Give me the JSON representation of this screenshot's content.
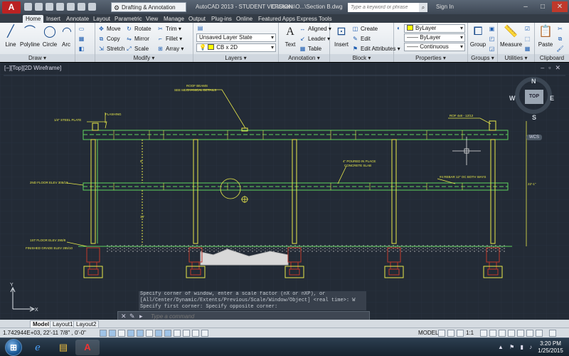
{
  "titlebar": {
    "app_logo": "A",
    "workspace": "Drafting & Annotation",
    "title": "AutoCAD 2013 - STUDENT VERSION",
    "file": "C:\\Users\\O...\\Section B.dwg",
    "search_placeholder": "Type a keyword or phrase",
    "sign_in": "Sign In"
  },
  "tabs": [
    "Home",
    "Insert",
    "Annotate",
    "Layout",
    "Parametric",
    "View",
    "Manage",
    "Output",
    "Plug-ins",
    "Online",
    "Featured Apps",
    "Express Tools"
  ],
  "ribbon": {
    "draw": {
      "title": "Draw ▾",
      "line": "Line",
      "polyline": "Polyline",
      "circle": "Circle",
      "arc": "Arc"
    },
    "modify": {
      "title": "Modify ▾",
      "move": "Move",
      "rotate": "Rotate",
      "trim": "Trim ▾",
      "copy": "Copy",
      "mirror": "Mirror",
      "fillet": "Fillet ▾",
      "stretch": "Stretch",
      "scale": "Scale",
      "array": "Array ▾"
    },
    "layers": {
      "title": "Layers ▾",
      "layer_state": "Unsaved Layer State",
      "current_layer": "CB x 2D"
    },
    "annotation": {
      "title": "Annotation ▾",
      "text": "Text",
      "aligned": "Aligned ▾",
      "leader": "Leader ▾",
      "table": "Table"
    },
    "block": {
      "title": "Block ▾",
      "insert": "Insert",
      "create": "Create",
      "edit": "Edit",
      "edit_attributes": "Edit Attributes ▾"
    },
    "properties": {
      "title": "Properties ▾",
      "color": "ByLayer",
      "linetype": "ByLayer",
      "lineweight": "Continuous"
    },
    "groups": {
      "title": "Groups ▾",
      "group": "Group"
    },
    "utilities": {
      "title": "Utilities ▾",
      "measure": "Measure"
    },
    "clipboard": {
      "title": "Clipboard",
      "paste": "Paste"
    }
  },
  "viewport": {
    "label": "[−][Top][2D Wireframe]"
  },
  "viewcube": {
    "top": "TOP",
    "north": "N",
    "south": "S",
    "east": "E",
    "west": "W",
    "wcs": "WCS"
  },
  "drawing_labels": {
    "roof_beams": "ROOF BEAMS",
    "mech_details": "SEE MECHANICAL DETAILS",
    "steel_plate": "1/4\" STEEL PLATE",
    "flashing": "FLASHING",
    "rof": "ROF 4x8 - 12/12",
    "poured_1": "4\" POURED IN PLACE",
    "poured_2": "CONCRETE SLAB",
    "rebar": "#4 REBAR 12\" OC BOTH WAYS",
    "second_floor": "2ND FLOOR ELEV 305/18",
    "first_floor": "1ST FLOOR ELEV 290/8",
    "finished_grade": "FINISHED GRADE ELEV 285/10",
    "dim_right": "22'-1\"",
    "dim_1": "9'",
    "dim_2": "10'"
  },
  "command": {
    "history": [
      "Specify corner of window, enter a scale factor (nX or nXP), or",
      "[All/Center/Dynamic/Extents/Previous/Scale/Window/Object] <real time>: W",
      "Specify first corner: Specify opposite corner:"
    ],
    "placeholder": "Type a command"
  },
  "layout_tabs": [
    "Model",
    "Layout1",
    "Layout2"
  ],
  "status": {
    "coords": "1.742944E+03, 22'-11 7/8\" , 0'-0\"",
    "model": "MODEL",
    "scale": "1:1"
  },
  "taskbar": {
    "time": "3:20 PM",
    "date": "1/25/2015"
  },
  "colors": {
    "drawing_bg": "#232b36",
    "structure": "#e8e84a",
    "slab": "#5fd35f",
    "accent": "#2e7bd6"
  }
}
